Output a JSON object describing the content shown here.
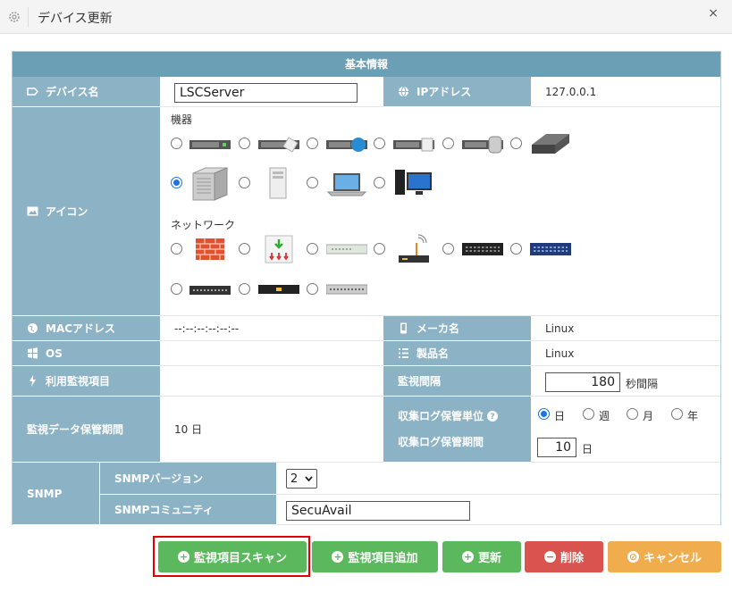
{
  "window": {
    "title": "デバイス更新",
    "close_label": "×"
  },
  "section_title": "基本情報",
  "device_name": {
    "label": "デバイス名",
    "value": "LSCServer"
  },
  "ip": {
    "label": "IPアドレス",
    "value": "127.0.0.1"
  },
  "icon": {
    "label": "アイコン",
    "group_devices": "機器",
    "group_network": "ネットワーク",
    "selected": "server-tower"
  },
  "mac": {
    "label": "MACアドレス",
    "value": "--:--:--:--:--:--"
  },
  "maker": {
    "label": "メーカ名",
    "value": "Linux"
  },
  "os": {
    "label": "OS",
    "value": ""
  },
  "product": {
    "label": "製品名",
    "value": "Linux"
  },
  "monitor_items": {
    "label": "利用監視項目",
    "value": ""
  },
  "interval": {
    "label": "監視間隔",
    "value": "180",
    "unit": "秒間隔"
  },
  "retention": {
    "label": "監視データ保管期間",
    "value": "10 日"
  },
  "log_unit": {
    "label": "収集ログ保管単位",
    "options": [
      "日",
      "週",
      "月",
      "年"
    ],
    "selected": "日"
  },
  "log_period": {
    "label": "収集ログ保管期間",
    "value": "10",
    "unit": "日"
  },
  "snmp": {
    "label": "SNMP",
    "version_label": "SNMPバージョン",
    "version_value": "2",
    "community_label": "SNMPコミュニティ",
    "community_value": "SecuAvail"
  },
  "buttons": {
    "scan": "監視項目スキャン",
    "add": "監視項目追加",
    "update": "更新",
    "delete": "削除",
    "cancel": "キャンセル"
  },
  "colors": {
    "header": "#6a9fb5",
    "label_bg": "#8cb3c5",
    "green": "#5cb85c",
    "red": "#d9534f",
    "orange": "#f0ad4e",
    "highlight": "#e00000"
  }
}
